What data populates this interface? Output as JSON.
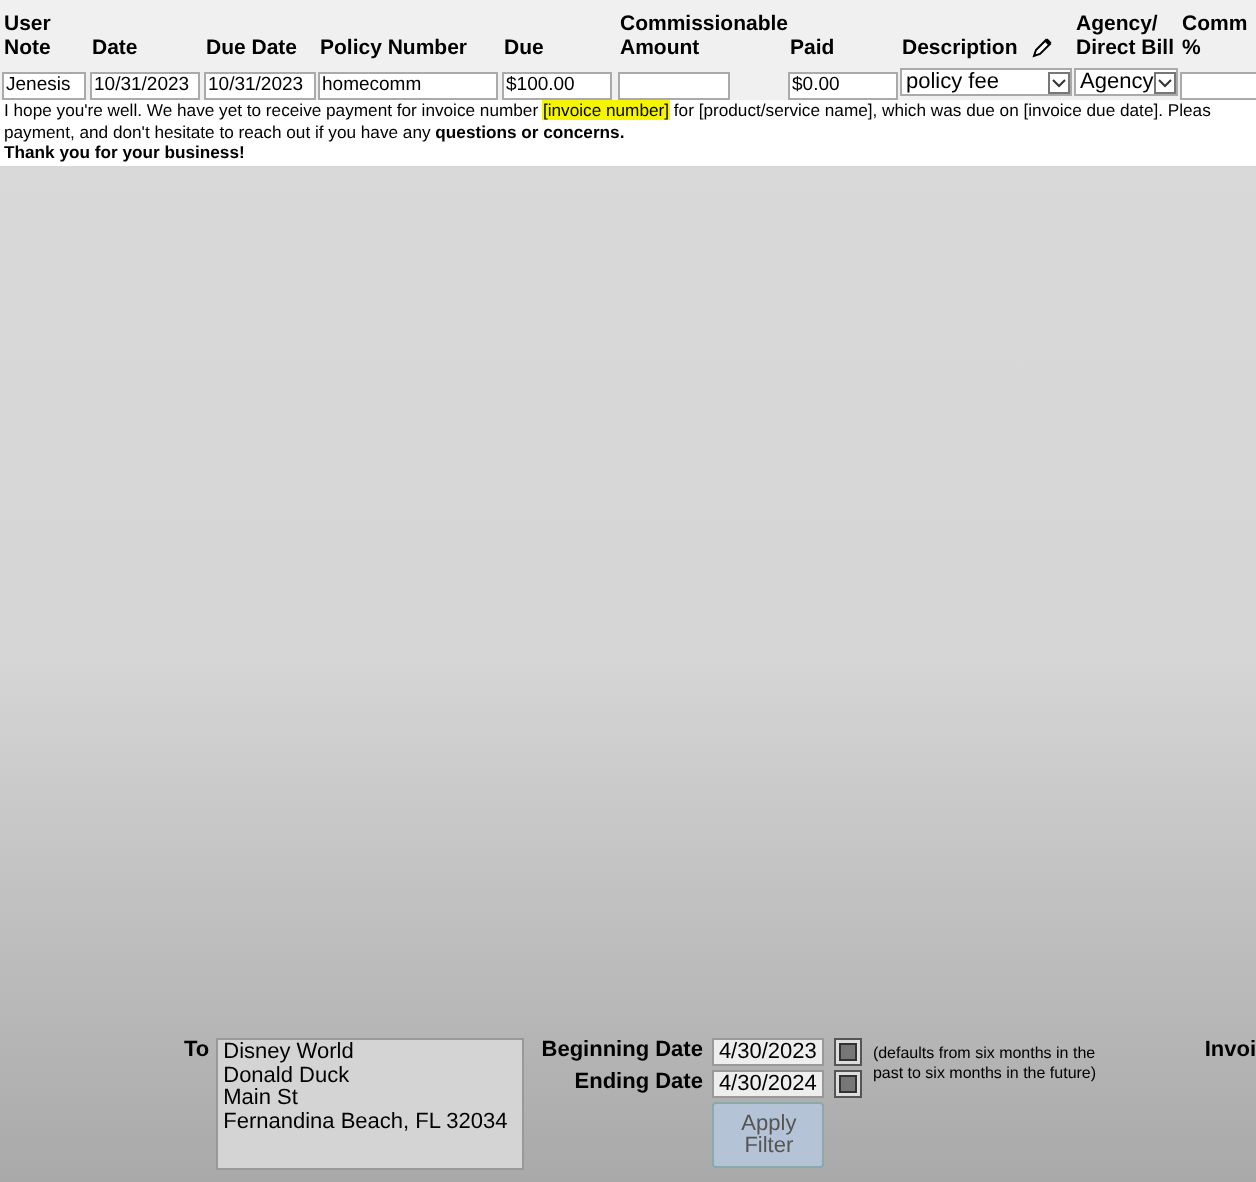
{
  "columns": [
    {
      "label": "User Note"
    },
    {
      "label": "Date"
    },
    {
      "label": "Due Date"
    },
    {
      "label": "Policy Number"
    },
    {
      "label": "Due"
    },
    {
      "label": "Commissionable Amount"
    },
    {
      "label": "Paid"
    },
    {
      "label": "Description"
    },
    {
      "label": "Agency/ Direct Bill"
    },
    {
      "label": "Comm %"
    }
  ],
  "row": [
    {
      "kind": "text",
      "value": "Jenesis"
    },
    {
      "kind": "text",
      "value": "10/31/2023"
    },
    {
      "kind": "text",
      "value": "10/31/2023"
    },
    {
      "kind": "text",
      "value": "homecomm"
    },
    {
      "kind": "text",
      "value": "$100.00"
    },
    {
      "kind": "text"
    },
    {
      "kind": "text",
      "value": "$0.00"
    },
    {
      "kind": "select",
      "value": "policy fee"
    },
    {
      "kind": "select",
      "value": "Agency"
    },
    {
      "kind": "text"
    }
  ],
  "note": {
    "lines": [
      {
        "parts": [
          {
            "text": "I hope you're well. We have yet to receive payment for invoice number ",
            "highlighted": false
          },
          {
            "text": "[invoice number]",
            "highlighted": true
          },
          {
            "text": " for [product/service name], which was due on [invoice due date]. Pleas",
            "highlighted": false
          }
        ]
      },
      {
        "parts": [
          {
            "text": "payment, and don't hesitate to reach out if you have any **questions or concerns.**",
            "highlighted": false
          }
        ]
      },
      {
        "parts": [
          {
            "text": "**Thank you for your business!**",
            "highlighted": false
          }
        ]
      }
    ]
  },
  "filter": {
    "to_label": "To",
    "address": [
      "Disney World",
      "Donald Duck",
      "Main St",
      "Fernandina Beach, FL 32034"
    ],
    "beginning_label": "Beginning Date",
    "beginning_value": "4/30/2023",
    "ending_label": "Ending Date",
    "ending_value": "4/30/2024",
    "hint": "(defaults from six months in the past to six months in the future)",
    "apply_button": "Apply Filter",
    "invoice_label": "Invoi"
  }
}
